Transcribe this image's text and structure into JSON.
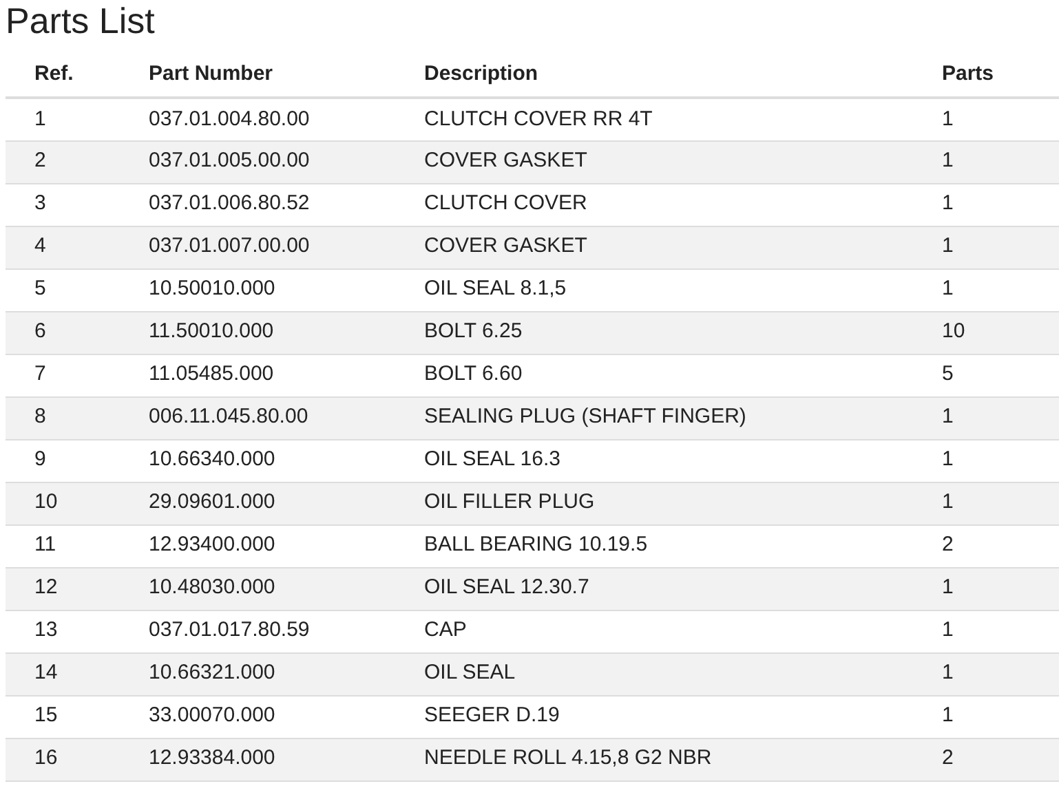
{
  "title": "Parts List",
  "table": {
    "columns": [
      "Ref.",
      "Part Number",
      "Description",
      "Parts"
    ],
    "rows": [
      [
        "1",
        "037.01.004.80.00",
        "CLUTCH COVER RR 4T",
        "1"
      ],
      [
        "2",
        "037.01.005.00.00",
        "COVER GASKET",
        "1"
      ],
      [
        "3",
        "037.01.006.80.52",
        "CLUTCH COVER",
        "1"
      ],
      [
        "4",
        "037.01.007.00.00",
        "COVER GASKET",
        "1"
      ],
      [
        "5",
        "10.50010.000",
        "OIL SEAL 8.1,5",
        "1"
      ],
      [
        "6",
        "11.50010.000",
        "BOLT 6.25",
        "10"
      ],
      [
        "7",
        "11.05485.000",
        "BOLT 6.60",
        "5"
      ],
      [
        "8",
        "006.11.045.80.00",
        "SEALING PLUG (SHAFT FINGER)",
        "1"
      ],
      [
        "9",
        "10.66340.000",
        "OIL SEAL 16.3",
        "1"
      ],
      [
        "10",
        "29.09601.000",
        "OIL FILLER PLUG",
        "1"
      ],
      [
        "11",
        "12.93400.000",
        "BALL BEARING 10.19.5",
        "2"
      ],
      [
        "12",
        "10.48030.000",
        "OIL SEAL 12.30.7",
        "1"
      ],
      [
        "13",
        "037.01.017.80.59",
        "CAP",
        "1"
      ],
      [
        "14",
        "10.66321.000",
        "OIL SEAL",
        "1"
      ],
      [
        "15",
        "33.00070.000",
        "SEEGER D.19",
        "1"
      ],
      [
        "16",
        "12.93384.000",
        "NEEDLE ROLL 4.15,8 G2 NBR",
        "2"
      ]
    ]
  }
}
